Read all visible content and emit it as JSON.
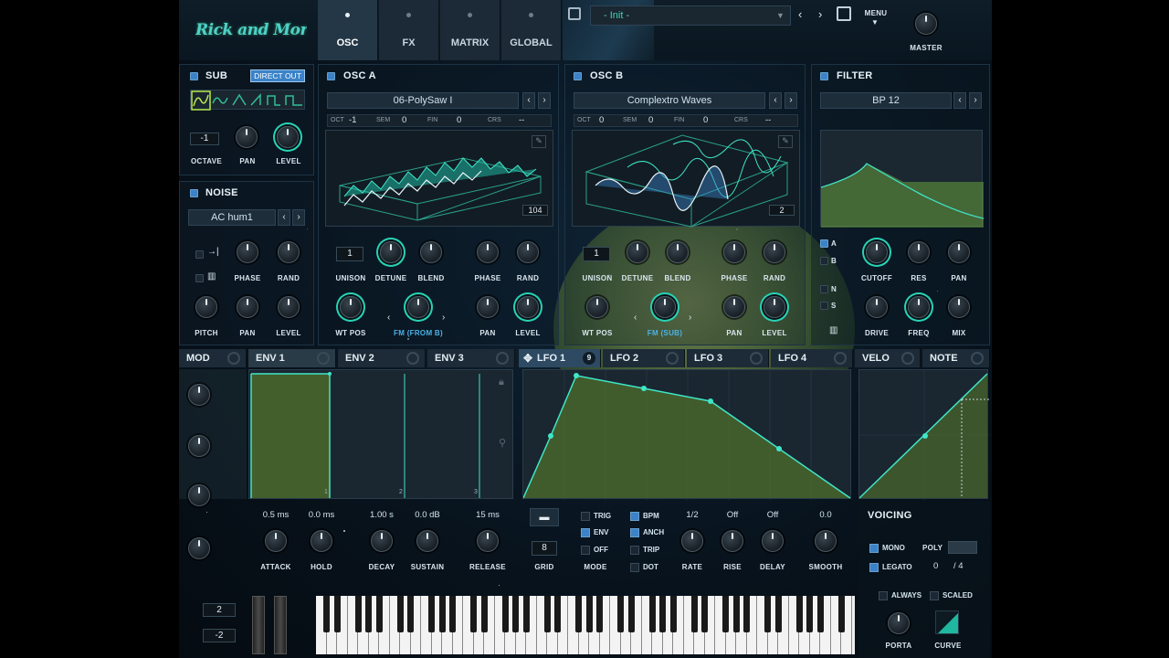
{
  "header": {
    "logo_text": "Rick and Morty",
    "tabs": [
      "OSC",
      "FX",
      "MATRIX",
      "GLOBAL"
    ],
    "preset_name": "- Init -",
    "menu_label": "MENU",
    "master_label": "MASTER"
  },
  "sub": {
    "title": "SUB",
    "direct_out": "DIRECT OUT",
    "octave_value": "-1",
    "knobs": [
      "OCTAVE",
      "PAN",
      "LEVEL"
    ]
  },
  "noise": {
    "title": "NOISE",
    "preset": "AC hum1",
    "row1": [
      "PHASE",
      "RAND"
    ],
    "row2": [
      "PITCH",
      "PAN",
      "LEVEL"
    ]
  },
  "osc_a": {
    "title": "OSC A",
    "wavetable": "06-PolySaw I",
    "oct_label": "OCT",
    "oct": "-1",
    "sem_label": "SEM",
    "sem": "0",
    "fin_label": "FIN",
    "fin": "0",
    "crs_label": "CRS",
    "crs": "--",
    "frame": "104",
    "unison": "1",
    "row1": [
      "UNISON",
      "DETUNE",
      "BLEND",
      "PHASE",
      "RAND"
    ],
    "row2": [
      "WT POS",
      "FM (FROM B)",
      "PAN",
      "LEVEL"
    ]
  },
  "osc_b": {
    "title": "OSC B",
    "wavetable": "Complextro Waves",
    "oct_label": "OCT",
    "oct": "0",
    "sem_label": "SEM",
    "sem": "0",
    "fin_label": "FIN",
    "fin": "0",
    "crs_label": "CRS",
    "crs": "--",
    "frame": "2",
    "unison": "1",
    "row1": [
      "UNISON",
      "DETUNE",
      "BLEND",
      "PHASE",
      "RAND"
    ],
    "row2": [
      "WT POS",
      "FM (SUB)",
      "PAN",
      "LEVEL"
    ]
  },
  "filter": {
    "title": "FILTER",
    "type": "BP 12",
    "routes": [
      "A",
      "B",
      "N",
      "S"
    ],
    "row1": [
      "CUTOFF",
      "RES",
      "PAN"
    ],
    "row2": [
      "DRIVE",
      "FREQ",
      "MIX"
    ]
  },
  "mod_tabs": [
    "MOD",
    "ENV 1",
    "ENV 2",
    "ENV 3",
    "LFO 1",
    "LFO 2",
    "LFO 3",
    "LFO 4",
    "VELO",
    "NOTE"
  ],
  "lfo1_badge": "9",
  "env": {
    "values": [
      "0.5 ms",
      "0.0 ms",
      "1.00 s",
      "0.0 dB",
      "15 ms"
    ],
    "labels": [
      "ATTACK",
      "HOLD",
      "DECAY",
      "SUSTAIN",
      "RELEASE"
    ],
    "markers": [
      "1",
      "2",
      "3"
    ]
  },
  "lfo": {
    "grid_label": "GRID",
    "grid": "8",
    "mode_label": "MODE",
    "mode_opts": [
      "TRIG",
      "ENV",
      "OFF"
    ],
    "sync_opts": [
      "BPM",
      "ANCH",
      "TRIP",
      "DOT"
    ],
    "values": [
      "1/2",
      "Off",
      "Off",
      "0.0"
    ],
    "labels": [
      "RATE",
      "RISE",
      "DELAY",
      "SMOOTH"
    ]
  },
  "voicing": {
    "title": "VOICING",
    "mono": "MONO",
    "poly": "POLY",
    "legato": "LEGATO",
    "voices": "0",
    "voices_max": "/ 4",
    "always": "ALWAYS",
    "scaled": "SCALED",
    "porta": "PORTA",
    "curve": "CURVE"
  },
  "pitch": {
    "up": "2",
    "down": "-2"
  },
  "colors": {
    "accent": "#27d3b5",
    "led": "#3b82c8",
    "panel": "#0c1a26"
  }
}
